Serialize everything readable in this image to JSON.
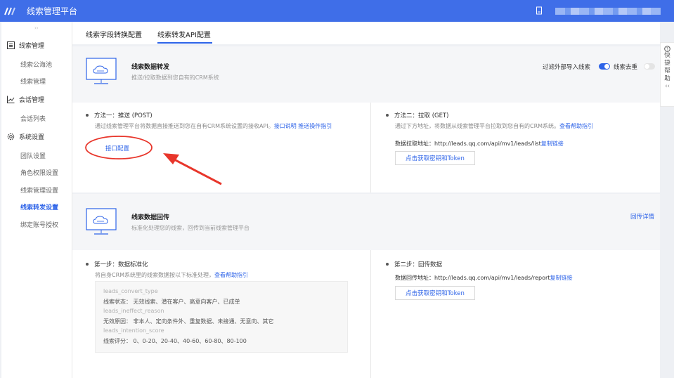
{
  "app": {
    "title": "线索管理平台"
  },
  "sidebar": {
    "groups": [
      {
        "label": "线索管理",
        "icon": "list-icon",
        "items": [
          "线索公海池",
          "线索管理"
        ]
      },
      {
        "label": "会话管理",
        "icon": "chart-line-icon",
        "items": [
          "会话列表"
        ]
      },
      {
        "label": "系统设置",
        "icon": "gear-icon",
        "items": [
          "团队设置",
          "角色权限设置",
          "线索管理设置",
          "线索转发设置",
          "绑定账号授权"
        ]
      }
    ],
    "active_item": "线索转发设置"
  },
  "tabs": [
    "线索字段转换配置",
    "线索转发API配置"
  ],
  "active_tab": "线索转发API配置",
  "forward": {
    "title": "线索数据转发",
    "subtitle": "推送/拉取数据到您自有的CRM系统",
    "filter_label": "过滤外部导入线索",
    "filter_on": true,
    "dedupe_label": "线索去重",
    "dedupe_on": false,
    "method1": {
      "title": "方法一：推送 (POST)",
      "desc": "通过线索管理平台将数据直接推送到您在自有CRM系统设置的接收API。",
      "link1": "接口说明",
      "link2": "推送操作指引",
      "button": "接口配置"
    },
    "method2": {
      "title": "方法二：拉取 (GET)",
      "desc": "通过下方地址，将数据从线索管理平台拉取到您自有的CRM系统。",
      "link": "查看帮助指引",
      "url_label": "数据拉取地址：",
      "url": "http://leads.qq.com/api/mv1/leads/list",
      "copy": "复制链接",
      "button": "点击获取密钥和Token"
    }
  },
  "callback": {
    "title": "线索数据回传",
    "subtitle": "标准化处理您的线索，回传到当前线索管理平台",
    "detail_link": "回传详情",
    "step1": {
      "title": "第一步：数据标准化",
      "desc": "将自身CRM系统里的线索数据按以下标准处理，",
      "link": "查看帮助指引",
      "fields": [
        {
          "key": "leads_convert_type",
          "value": "线索状态：  无效线索、潜在客户、高意向客户、已成单"
        },
        {
          "key": "leads_ineffect_reason",
          "value": "无效原因：  非本人、定向条件外、重复数据、未接通、无意向、其它"
        },
        {
          "key": "leads_intention_score",
          "value": "线索评分：  0、0-20、20-40、40-60、60-80、80-100"
        }
      ]
    },
    "step2": {
      "title": "第二步：回传数据",
      "url_label": "数据回传地址：",
      "url": "http://leads.qq.com/api/mv1/leads/report",
      "copy": "复制链接",
      "button": "点击获取密钥和Token"
    }
  },
  "help_rail": {
    "chars": [
      "快",
      "捷",
      "帮",
      "助"
    ]
  },
  "colors": {
    "topbar": "#3f6ee8",
    "accent": "#2d63e8",
    "annotation": "#e8362b"
  }
}
